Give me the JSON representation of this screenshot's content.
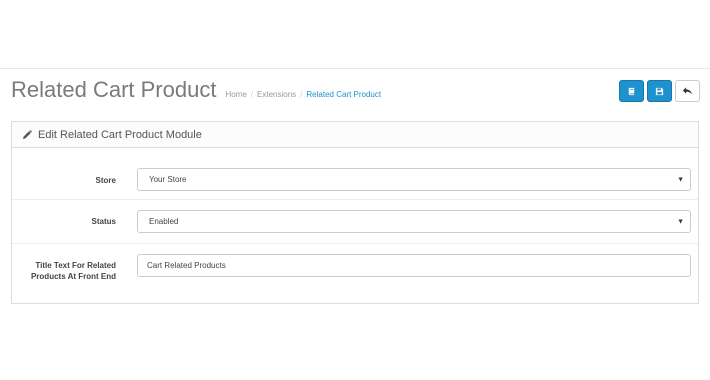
{
  "header": {
    "title": "Related Cart Product",
    "breadcrumb": [
      {
        "label": "Home"
      },
      {
        "label": "Extensions"
      },
      {
        "label": "Related Cart Product"
      }
    ],
    "breadcrumb_separator": "/"
  },
  "actions": {
    "buttons": [
      {
        "icon": "book-icon",
        "style": "primary"
      },
      {
        "icon": "save-icon",
        "style": "primary"
      },
      {
        "icon": "back-arrow-icon",
        "style": "default"
      }
    ]
  },
  "panel": {
    "icon": "pencil-icon",
    "title": "Edit Related Cart Product Module"
  },
  "form": {
    "store": {
      "label": "Store",
      "value": "Your Store",
      "caret": "▼"
    },
    "status": {
      "label": "Status",
      "value": "Enabled",
      "caret": "▼"
    },
    "title_text": {
      "label": "Title Text For Related Products At Front End",
      "value": "Cart Related Products"
    }
  },
  "colors": {
    "primary": "#1e91cf",
    "title_gray": "#7a7a7a",
    "border": "#dddddd"
  }
}
